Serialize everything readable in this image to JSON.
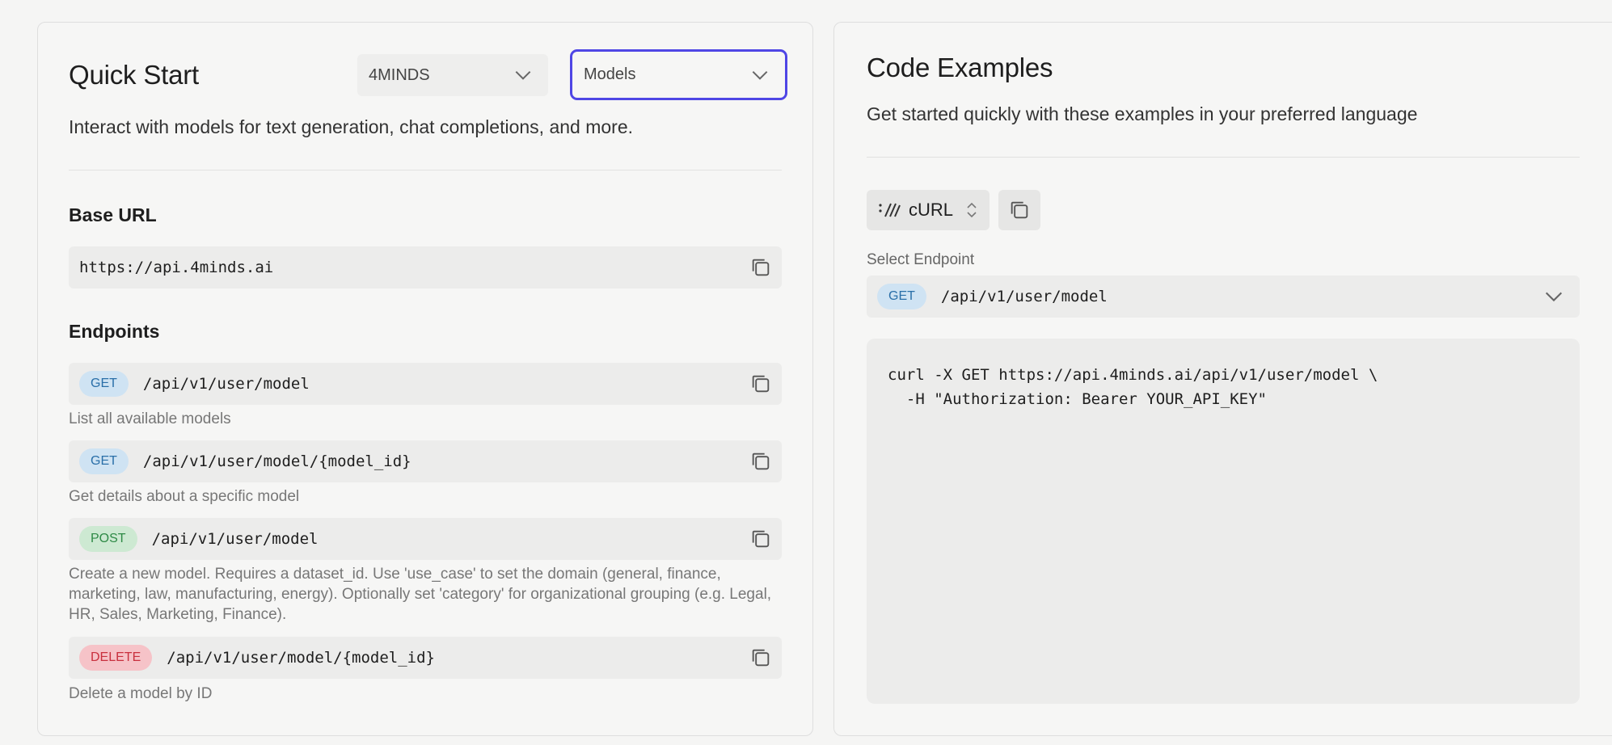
{
  "quick_start": {
    "title": "Quick Start",
    "org_select": {
      "value": "4MINDS"
    },
    "resource_select": {
      "value": "Models"
    },
    "description": "Interact with models for text generation, chat completions, and more.",
    "base_url": {
      "title": "Base URL",
      "value": "https://api.4minds.ai"
    },
    "endpoints": {
      "title": "Endpoints",
      "items": [
        {
          "method": "GET",
          "path": "/api/v1/user/model",
          "description": "List all available models"
        },
        {
          "method": "GET",
          "path": "/api/v1/user/model/{model_id}",
          "description": "Get details about a specific model"
        },
        {
          "method": "POST",
          "path": "/api/v1/user/model",
          "description": "Create a new model. Requires a dataset_id. Use 'use_case' to set the domain (general, finance, marketing, law, manufacturing, energy). Optionally set 'category' for organizational grouping (e.g. Legal, HR, Sales, Marketing, Finance)."
        },
        {
          "method": "DELETE",
          "path": "/api/v1/user/model/{model_id}",
          "description": "Delete a model by ID"
        }
      ]
    }
  },
  "code_examples": {
    "title": "Code Examples",
    "description": "Get started quickly with these examples in your preferred language",
    "language": "cURL",
    "select_endpoint_label": "Select Endpoint",
    "selected_endpoint": {
      "method": "GET",
      "path": "/api/v1/user/model"
    },
    "code": "curl -X GET https://api.4minds.ai/api/v1/user/model \\\n  -H \"Authorization: Bearer YOUR_API_KEY\""
  },
  "colors": {
    "accent": "#4f46e5",
    "get": "#2a6fa8",
    "post": "#2e8a46",
    "delete": "#c9303e"
  }
}
